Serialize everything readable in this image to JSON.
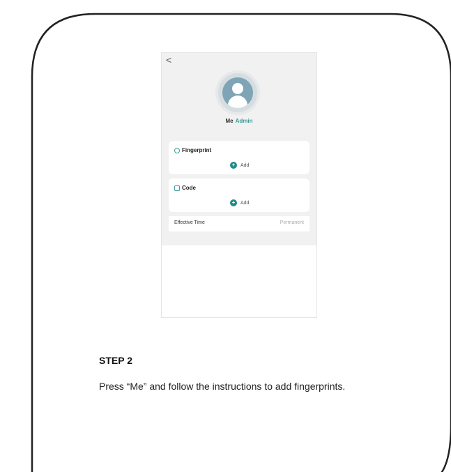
{
  "phone": {
    "back_label": "<",
    "user_name": "Me",
    "user_role": "Admin",
    "sections": [
      {
        "title": "Fingerprint",
        "icon": "fingerprint-icon",
        "add_label": "Add"
      },
      {
        "title": "Code",
        "icon": "code-icon",
        "add_label": "Add"
      }
    ],
    "effective_time": {
      "label": "Effective Time",
      "value": "Permanent"
    }
  },
  "step": {
    "title": "STEP 2",
    "text": "Press “Me” and follow the instructions to add fingerprints."
  },
  "colors": {
    "accent": "#1f8b87",
    "background": "#f1f1f1"
  }
}
